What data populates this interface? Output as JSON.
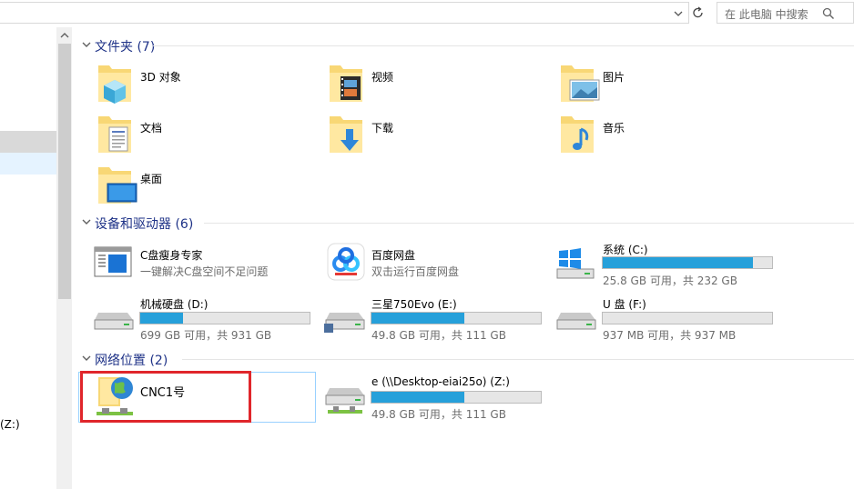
{
  "search": {
    "placeholder": "在 此电脑 中搜索"
  },
  "nav": {
    "drive_z_label": "(Z:)"
  },
  "groups": {
    "folders": {
      "title": "文件夹 (7)"
    },
    "devices": {
      "title": "设备和驱动器 (6)"
    },
    "network": {
      "title": "网络位置 (2)"
    }
  },
  "folders": [
    {
      "name": "3D 对象",
      "icon": "3d-objects-folder-icon"
    },
    {
      "name": "视频",
      "icon": "videos-folder-icon"
    },
    {
      "name": "图片",
      "icon": "pictures-folder-icon"
    },
    {
      "name": "文档",
      "icon": "documents-folder-icon"
    },
    {
      "name": "下载",
      "icon": "downloads-folder-icon"
    },
    {
      "name": "音乐",
      "icon": "music-folder-icon"
    },
    {
      "name": "桌面",
      "icon": "desktop-folder-icon"
    }
  ],
  "devices": [
    {
      "name": "C盘瘦身专家",
      "sub": "一键解决C盘空间不足问题",
      "icon": "c-cleaner-app-icon"
    },
    {
      "name": "百度网盘",
      "sub": "双击运行百度网盘",
      "icon": "baidu-netdisk-icon"
    },
    {
      "name": "系统 (C:)",
      "sub": "25.8 GB 可用，共 232 GB",
      "used_fraction": 0.889,
      "icon": "windows-drive-icon"
    },
    {
      "name": "机械硬盘 (D:)",
      "sub": "699 GB 可用，共 931 GB",
      "used_fraction": 0.25,
      "icon": "hard-drive-icon"
    },
    {
      "name": "三星750Evo (E:)",
      "sub": "49.8 GB 可用，共 111 GB",
      "used_fraction": 0.551,
      "icon": "hard-drive-icon"
    },
    {
      "name": "U 盘 (F:)",
      "sub": "937 MB 可用，共 937 MB",
      "used_fraction": 0.0,
      "icon": "usb-drive-icon"
    }
  ],
  "network": [
    {
      "name": "CNC1号",
      "icon": "network-location-icon"
    },
    {
      "name": "e (\\\\Desktop-eiai25o) (Z:)",
      "sub": "49.8 GB 可用，共 111 GB",
      "used_fraction": 0.551,
      "icon": "network-drive-icon"
    }
  ],
  "colors": {
    "accent": "#26a0da",
    "group_title": "#1e3287",
    "highlight": "#e0262b",
    "selection": "#99d1ff"
  }
}
